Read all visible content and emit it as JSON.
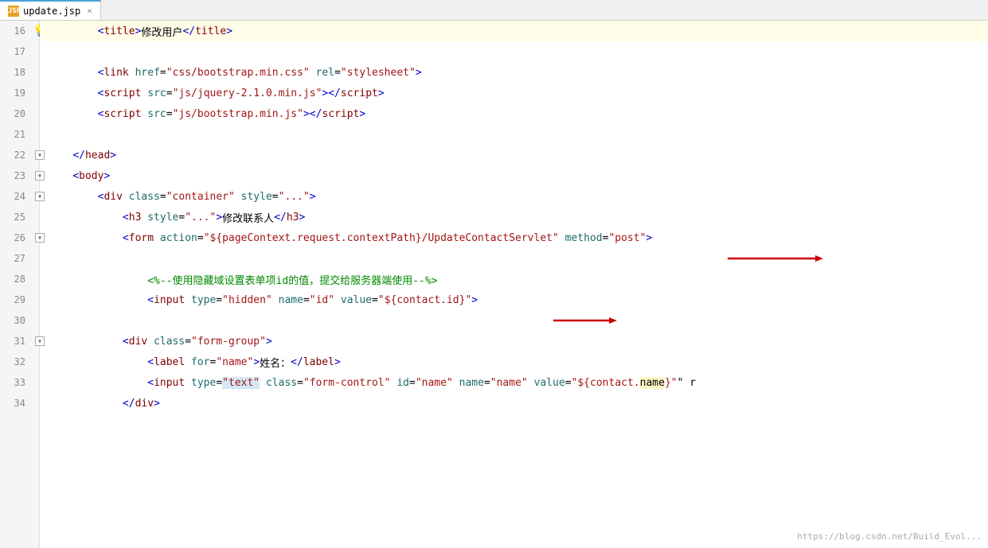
{
  "tab": {
    "filename": "update.jsp",
    "icon_label": "JSP",
    "close_label": "×"
  },
  "lines": [
    {
      "num": 16,
      "has_bulb": true,
      "highlighted": true,
      "indent": "        ",
      "tokens": [
        {
          "type": "tag-open",
          "text": "<"
        },
        {
          "type": "el",
          "text": "title"
        },
        {
          "type": "tag-close",
          "text": ">"
        },
        {
          "type": "text",
          "text": "修改用户"
        },
        {
          "type": "tag-open",
          "text": "</"
        },
        {
          "type": "el",
          "text": "title"
        },
        {
          "type": "tag-close",
          "text": ">"
        }
      ]
    },
    {
      "num": 17,
      "tokens": []
    },
    {
      "num": 18,
      "indent": "        ",
      "tokens": [
        {
          "type": "tag-open",
          "text": "<"
        },
        {
          "type": "el",
          "text": "link"
        },
        {
          "type": "space",
          "text": " "
        },
        {
          "type": "attr",
          "text": "href"
        },
        {
          "type": "eq",
          "text": "="
        },
        {
          "type": "string",
          "text": "\"css/bootstrap.min.css\""
        },
        {
          "type": "space",
          "text": " "
        },
        {
          "type": "attr",
          "text": "rel"
        },
        {
          "type": "eq",
          "text": "="
        },
        {
          "type": "string",
          "text": "\"stylesheet\""
        },
        {
          "type": "tag-close",
          "text": ">"
        }
      ]
    },
    {
      "num": 19,
      "indent": "        ",
      "tokens": [
        {
          "type": "tag-open",
          "text": "<"
        },
        {
          "type": "el",
          "text": "script"
        },
        {
          "type": "space",
          "text": " "
        },
        {
          "type": "attr",
          "text": "src"
        },
        {
          "type": "eq",
          "text": "="
        },
        {
          "type": "string",
          "text": "\"js/jquery-2.1.0.min.js\""
        },
        {
          "type": "tag-close2",
          "text": "></"
        },
        {
          "type": "el2",
          "text": "script"
        },
        {
          "type": "tag-close",
          "text": ">"
        }
      ]
    },
    {
      "num": 20,
      "indent": "        ",
      "tokens": [
        {
          "type": "tag-open",
          "text": "<"
        },
        {
          "type": "el",
          "text": "script"
        },
        {
          "type": "space",
          "text": " "
        },
        {
          "type": "attr",
          "text": "src"
        },
        {
          "type": "eq",
          "text": "="
        },
        {
          "type": "string",
          "text": "\"js/bootstrap.min.js\""
        },
        {
          "type": "tag-close2",
          "text": "></"
        },
        {
          "type": "el2",
          "text": "script"
        },
        {
          "type": "tag-close",
          "text": ">"
        }
      ]
    },
    {
      "num": 21,
      "tokens": []
    },
    {
      "num": 22,
      "has_fold": true,
      "fold_open": false,
      "indent": "    ",
      "tokens": [
        {
          "type": "tag-open",
          "text": "</"
        },
        {
          "type": "el",
          "text": "head"
        },
        {
          "type": "tag-close",
          "text": ">"
        }
      ]
    },
    {
      "num": 23,
      "has_fold": true,
      "fold_open": false,
      "indent": "    ",
      "tokens": [
        {
          "type": "tag-open",
          "text": "<"
        },
        {
          "type": "el",
          "text": "body"
        },
        {
          "type": "tag-close",
          "text": ">"
        }
      ]
    },
    {
      "num": 24,
      "has_fold": true,
      "fold_open": false,
      "indent": "        ",
      "tokens": [
        {
          "type": "tag-open",
          "text": "<"
        },
        {
          "type": "el",
          "text": "div"
        },
        {
          "type": "space",
          "text": " "
        },
        {
          "type": "attr",
          "text": "class"
        },
        {
          "type": "eq",
          "text": "="
        },
        {
          "type": "string",
          "text": "\"container\""
        },
        {
          "type": "space",
          "text": " "
        },
        {
          "type": "attr",
          "text": "style"
        },
        {
          "type": "eq",
          "text": "="
        },
        {
          "type": "string",
          "text": "\"...\""
        },
        {
          "type": "tag-close",
          "text": ">"
        }
      ]
    },
    {
      "num": 25,
      "indent": "            ",
      "tokens": [
        {
          "type": "tag-open",
          "text": "<"
        },
        {
          "type": "el",
          "text": "h3"
        },
        {
          "type": "space",
          "text": " "
        },
        {
          "type": "attr",
          "text": "style"
        },
        {
          "type": "eq",
          "text": "="
        },
        {
          "type": "string",
          "text": "\"...\""
        },
        {
          "type": "tag-close",
          "text": ">"
        },
        {
          "type": "text",
          "text": "修改联系人"
        },
        {
          "type": "tag-open",
          "text": "</"
        },
        {
          "type": "el",
          "text": "h3"
        },
        {
          "type": "tag-close",
          "text": ">"
        }
      ]
    },
    {
      "num": 26,
      "has_fold": true,
      "fold_open": false,
      "indent": "            ",
      "has_arrow": true,
      "arrow_long": true,
      "tokens": [
        {
          "type": "tag-open",
          "text": "<"
        },
        {
          "type": "el",
          "text": "form"
        },
        {
          "type": "space",
          "text": " "
        },
        {
          "type": "attr",
          "text": "action"
        },
        {
          "type": "eq",
          "text": "="
        },
        {
          "type": "string",
          "text": "\"${pageContext.request.contextPath}/UpdateContactServlet\""
        },
        {
          "type": "space",
          "text": " "
        },
        {
          "type": "attr",
          "text": "method"
        },
        {
          "type": "eq",
          "text": "="
        },
        {
          "type": "string",
          "text": "\"post\""
        },
        {
          "type": "tag-close",
          "text": ">"
        }
      ]
    },
    {
      "num": 27,
      "tokens": []
    },
    {
      "num": 28,
      "indent": "                ",
      "tokens": [
        {
          "type": "comment",
          "text": "<%--使用隐藏域设置表单项id的值，提交给服务器端使用--%>"
        }
      ]
    },
    {
      "num": 29,
      "indent": "                ",
      "has_arrow": true,
      "arrow_long": false,
      "tokens": [
        {
          "type": "tag-open",
          "text": "<"
        },
        {
          "type": "el",
          "text": "input"
        },
        {
          "type": "space",
          "text": " "
        },
        {
          "type": "attr",
          "text": "type"
        },
        {
          "type": "eq",
          "text": "="
        },
        {
          "type": "string",
          "text": "\"hidden\""
        },
        {
          "type": "space",
          "text": " "
        },
        {
          "type": "attr",
          "text": "name"
        },
        {
          "type": "eq",
          "text": "="
        },
        {
          "type": "string",
          "text": "\"id\""
        },
        {
          "type": "space",
          "text": " "
        },
        {
          "type": "attr",
          "text": "value"
        },
        {
          "type": "eq",
          "text": "="
        },
        {
          "type": "string-expr",
          "text": "\"${contact.id}\""
        },
        {
          "type": "tag-close",
          "text": ">"
        }
      ]
    },
    {
      "num": 30,
      "tokens": []
    },
    {
      "num": 31,
      "has_fold": true,
      "fold_open": false,
      "indent": "            ",
      "tokens": [
        {
          "type": "tag-open",
          "text": "<"
        },
        {
          "type": "el",
          "text": "div"
        },
        {
          "type": "space",
          "text": " "
        },
        {
          "type": "attr",
          "text": "class"
        },
        {
          "type": "eq",
          "text": "="
        },
        {
          "type": "string",
          "text": "\"form-group\""
        },
        {
          "type": "tag-close",
          "text": ">"
        }
      ]
    },
    {
      "num": 32,
      "indent": "                ",
      "tokens": [
        {
          "type": "tag-open",
          "text": "<"
        },
        {
          "type": "el",
          "text": "label"
        },
        {
          "type": "space",
          "text": " "
        },
        {
          "type": "attr",
          "text": "for"
        },
        {
          "type": "eq",
          "text": "="
        },
        {
          "type": "string",
          "text": "\"name\""
        },
        {
          "type": "tag-close",
          "text": ">"
        },
        {
          "type": "text",
          "text": "姓名："
        },
        {
          "type": "tag-open",
          "text": "</"
        },
        {
          "type": "el",
          "text": "label"
        },
        {
          "type": "tag-close",
          "text": ">"
        }
      ]
    },
    {
      "num": 33,
      "indent": "                ",
      "tokens": [
        {
          "type": "tag-open",
          "text": "<"
        },
        {
          "type": "el",
          "text": "input"
        },
        {
          "type": "space",
          "text": " "
        },
        {
          "type": "attr",
          "text": "type"
        },
        {
          "type": "eq",
          "text": "="
        },
        {
          "type": "string-hl",
          "text": "\"text\""
        },
        {
          "type": "space",
          "text": " "
        },
        {
          "type": "attr",
          "text": "class"
        },
        {
          "type": "eq",
          "text": "="
        },
        {
          "type": "string",
          "text": "\"form-control\""
        },
        {
          "type": "space",
          "text": " "
        },
        {
          "type": "attr",
          "text": "id"
        },
        {
          "type": "eq",
          "text": "="
        },
        {
          "type": "string",
          "text": "\"name\""
        },
        {
          "type": "space",
          "text": " "
        },
        {
          "type": "attr",
          "text": "name"
        },
        {
          "type": "eq",
          "text": "="
        },
        {
          "type": "string",
          "text": "\"name\""
        },
        {
          "type": "space",
          "text": " "
        },
        {
          "type": "attr",
          "text": "value"
        },
        {
          "type": "eq",
          "text": "="
        },
        {
          "type": "string-expr2",
          "text": "\"${contact.name}\""
        },
        {
          "type": "text",
          "text": "\" r"
        }
      ]
    },
    {
      "num": 34,
      "indent": "            ",
      "tokens": [
        {
          "type": "tag-open",
          "text": "</"
        },
        {
          "type": "el",
          "text": "div"
        },
        {
          "type": "tag-close",
          "text": ">"
        }
      ]
    }
  ],
  "watermark": "https://blog.csdn.net/Build_Evol..."
}
